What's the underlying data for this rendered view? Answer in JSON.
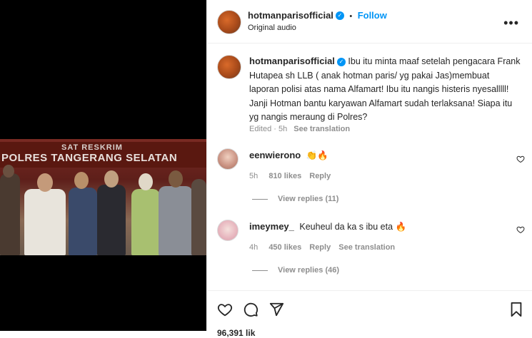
{
  "video": {
    "banner_line1": "SAT RESKRIM",
    "banner_line2": "POLRES TANGERANG SELATAN"
  },
  "header": {
    "username": "hotmanparisofficial",
    "separator": "•",
    "follow_label": "Follow",
    "audio_label": "Original audio",
    "more_label": "•••"
  },
  "caption": {
    "username": "hotmanparisofficial",
    "text": "Ibu itu minta maaf setelah pengacara Frank Hutapea sh LLB ( anak hotman paris/ yg pakai Jas)membuat laporan polisi atas nama Alfamart! Ibu itu nangis histeris nyesalllll! Janji Hotman bantu karyawan Alfamart sudah terlaksana! Siapa itu yg nangis meraung di Polres?",
    "edited": "Edited · 5h",
    "see_translation": "See translation"
  },
  "comments": [
    {
      "username": "eenwierono",
      "text": "👏🔥",
      "time": "5h",
      "likes": "810 likes",
      "reply_label": "Reply",
      "view_replies": "View replies (11)"
    },
    {
      "username": "imeymey_",
      "text": "Keuheul da ka s ibu eta 🔥",
      "time": "4h",
      "likes": "450 likes",
      "reply_label": "Reply",
      "see_translation": "See translation",
      "view_replies": "View replies (46)"
    }
  ],
  "footer": {
    "likes_partial": "96,391 lik"
  },
  "colors": {
    "accent": "#0095f6",
    "muted": "#8e8e8e",
    "text": "#262626"
  },
  "icons": [
    "heart-icon",
    "comment-icon",
    "share-icon",
    "bookmark-icon",
    "more-icon",
    "verified-icon"
  ]
}
